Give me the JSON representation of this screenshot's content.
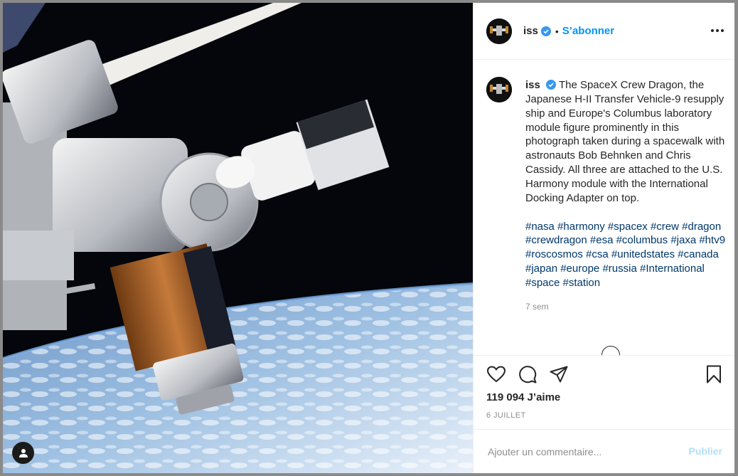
{
  "post": {
    "username": "iss",
    "follow_label": "S’abonner",
    "separator": "•",
    "caption": "The SpaceX Crew Dragon, the Japanese H-II Transfer Vehicle-9 resupply ship and Europe's Columbus laboratory module figure prominently in this photograph taken during a spacewalk with astronauts Bob Behnken and Chris Cassidy. All three are attached to the U.S. Harmony module with the International Docking Adapter on top.",
    "hashtags": [
      "#nasa",
      "#harmony",
      "#spacex",
      "#crew",
      "#dragon",
      "#crewdragon",
      "#esa",
      "#columbus",
      "#jaxa",
      "#htv9",
      "#roscosmos",
      "#csa",
      "#unitedstates",
      "#canada",
      "#japan",
      "#europe",
      "#russia",
      "#International",
      "#space",
      "#station"
    ],
    "time_ago": "7 sem",
    "likes": "119 094 J’aime",
    "date": "6 JUILLET"
  },
  "comment": {
    "placeholder": "Ajouter un commentaire...",
    "publish_label": "Publier"
  },
  "colors": {
    "accent": "#0095f6",
    "hashtag": "#00376b",
    "muted": "#8e8e8e",
    "publish_disabled": "#b2dffc"
  },
  "icons": [
    "user-tag-icon",
    "verified-badge-icon",
    "more-options-icon",
    "heart-icon",
    "comment-icon",
    "share-icon",
    "bookmark-icon",
    "load-more-icon"
  ]
}
